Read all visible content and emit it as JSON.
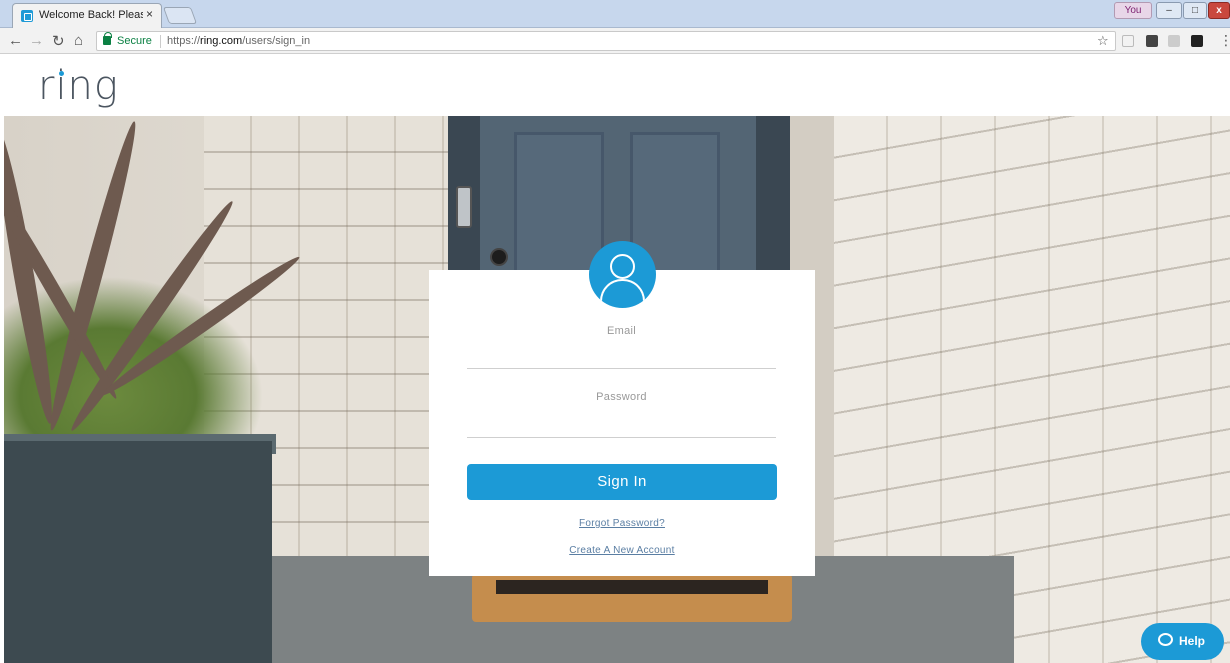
{
  "browser": {
    "tab_title": "Welcome Back! Please Lo",
    "tab_close": "×",
    "window_user": "You",
    "window_min": "–",
    "window_max": "□",
    "window_close": "x",
    "secure_label": "Secure",
    "url_scheme": "https://",
    "url_host": "ring.com",
    "url_path": "/users/sign_in"
  },
  "page": {
    "logo_text": "ring",
    "login": {
      "email_label": "Email",
      "password_label": "Password",
      "signin_button": "Sign In",
      "forgot_link": "Forgot Password?",
      "create_link": "Create A New Account"
    },
    "help_button": "Help"
  },
  "colors": {
    "accent": "#1c9ad6",
    "link": "#5a7ea3",
    "secure_green": "#0b8043"
  }
}
